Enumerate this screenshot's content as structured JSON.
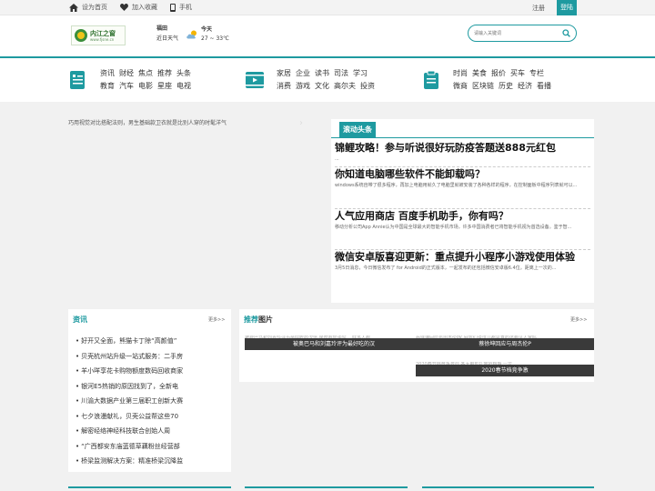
{
  "topbar": {
    "set_home": "设为首页",
    "add_favorite": "加入收藏",
    "mobile": "手机",
    "register": "注册",
    "login": "登陆"
  },
  "header": {
    "logo_title": "内江之窗",
    "logo_sub": "www.fjsne.cn",
    "city": "福田",
    "recent_weather": "近日天气",
    "today": "今天",
    "temp": "27 ~ 33℃",
    "search_placeholder": "请输入关键词"
  },
  "nav": {
    "groups": [
      {
        "row1": [
          "资讯",
          "财经",
          "焦点",
          "推荐",
          "头条"
        ],
        "row2": [
          "教育",
          "汽车",
          "电影",
          "星座",
          "电视"
        ]
      },
      {
        "row1": [
          "家居",
          "企业",
          "读书",
          "司法",
          "学习"
        ],
        "row2": [
          "消费",
          "游戏",
          "文化",
          "高尔夫",
          "投资"
        ]
      },
      {
        "row1": [
          "时尚",
          "美食",
          "报价",
          "买车",
          "专栏"
        ],
        "row2": [
          "微商",
          "区块链",
          "历史",
          "经济",
          "看播"
        ]
      }
    ]
  },
  "slider": {
    "caption": "巧用视觉对比搭配法则，男生基础款卫衣就是比别人穿的时髦洋气"
  },
  "headlines": {
    "tab": "滚动头条",
    "items": [
      {
        "title": "锦鲤攻略！参与听说很好玩防疫答题送888元红包",
        "desc": "..."
      },
      {
        "title": "你知道电脑哪些软件不能卸载吗？",
        "desc": "windows系统自带了很多程序，再加上电脑用就久了电脑里就被安装了各种各样的程序，在控制面板中程序列表就可以..."
      },
      {
        "title": "人气应用商店 百度手机助手，你有吗？",
        "desc": "移动分析公司App Annie认为中国是全球最大的智能手机市场，许多中国消费者已将智能手机视为首选设备。鉴于智..."
      },
      {
        "title": "微信安卓版喜迎更新：重点提升小程序小游戏使用体验",
        "desc": "3月5日消息，今日微信发布了 for Android的正式版本，一起发布的还包括微信安卓版6.4位。距离上一次的..."
      }
    ]
  },
  "news": {
    "title": "资讯",
    "more": "更多>>",
    "items": [
      "好开又全面，熊猫卡丁除“高颜值”",
      "贝壳杭州站升级一站式服务：二手房",
      "羊小咩享花卡购物额度数码回收商家",
      "银河E5热销的原因找到了，全新电",
      "川渝大数据产业第三届职工创新大赛",
      "七夕浪漫献礼，贝壳公益帮这些70",
      "解密经络神经科技联合创始人周",
      "“广西都安东庙蓝德草藕粉丝经营部",
      "桥梁监测解决方案：精准桥梁沉降监"
    ]
  },
  "pictures": {
    "title_prefix": "推荐",
    "title_suffix": "图片",
    "more": "更多>>",
    "items": [
      {
        "alt": "被费巴马和刘嘉玲评为最好吃的汉堡 居然有加油站 ...好多人都",
        "caption": "被奥巴马和刘嘉玲评为最好吃的汉"
      },
      {
        "alt": "蔡徐坤回应与周杰伦PK 网友们说这几都是真的还要见人家吗",
        "caption": "蔡徐坤回应与周杰伦P"
      },
      {
        "alt": "2020春节档竞争激烈 各大电影扎堆抢档期 一次",
        "caption": "2020春节档竞争激"
      }
    ]
  },
  "colors": {
    "accent": "#1e9aa0"
  }
}
